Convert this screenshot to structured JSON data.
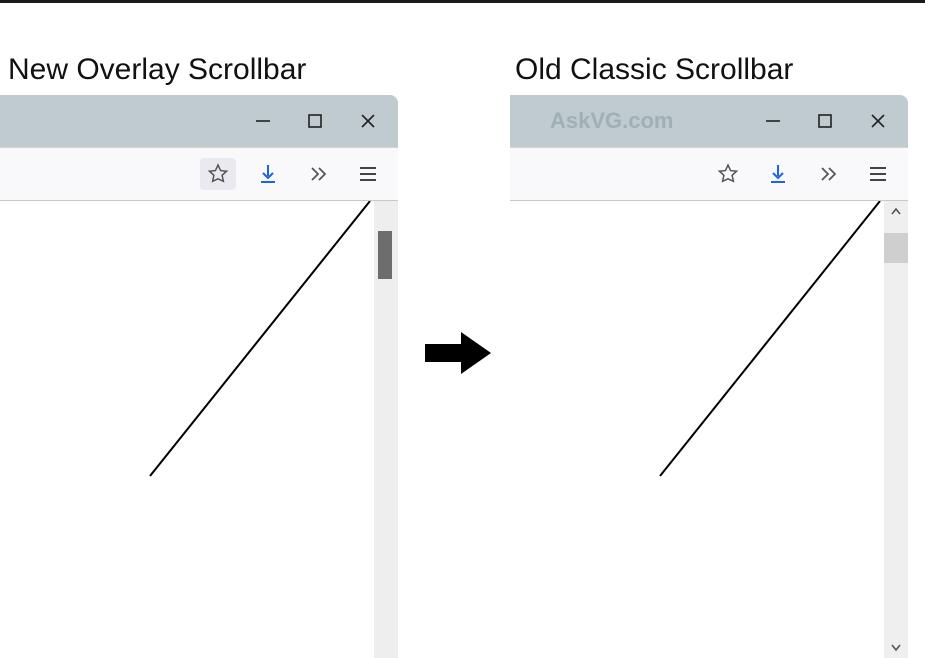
{
  "headings": {
    "left": "New Overlay Scrollbar",
    "right": "Old Classic Scrollbar"
  },
  "watermark": "AskVG.com",
  "window_controls": {
    "minimize": "minimize",
    "maximize": "maximize",
    "close": "close"
  },
  "toolbar_icons": {
    "favorite": "star-icon",
    "downloads": "downloads-icon",
    "overflow": "chevron-double-right-icon",
    "menu": "hamburger-icon"
  },
  "scrollbar_labels": {
    "overlay_thumb": "overlay-scrollbar-thumb",
    "classic_thumb": "classic-scrollbar-thumb"
  }
}
